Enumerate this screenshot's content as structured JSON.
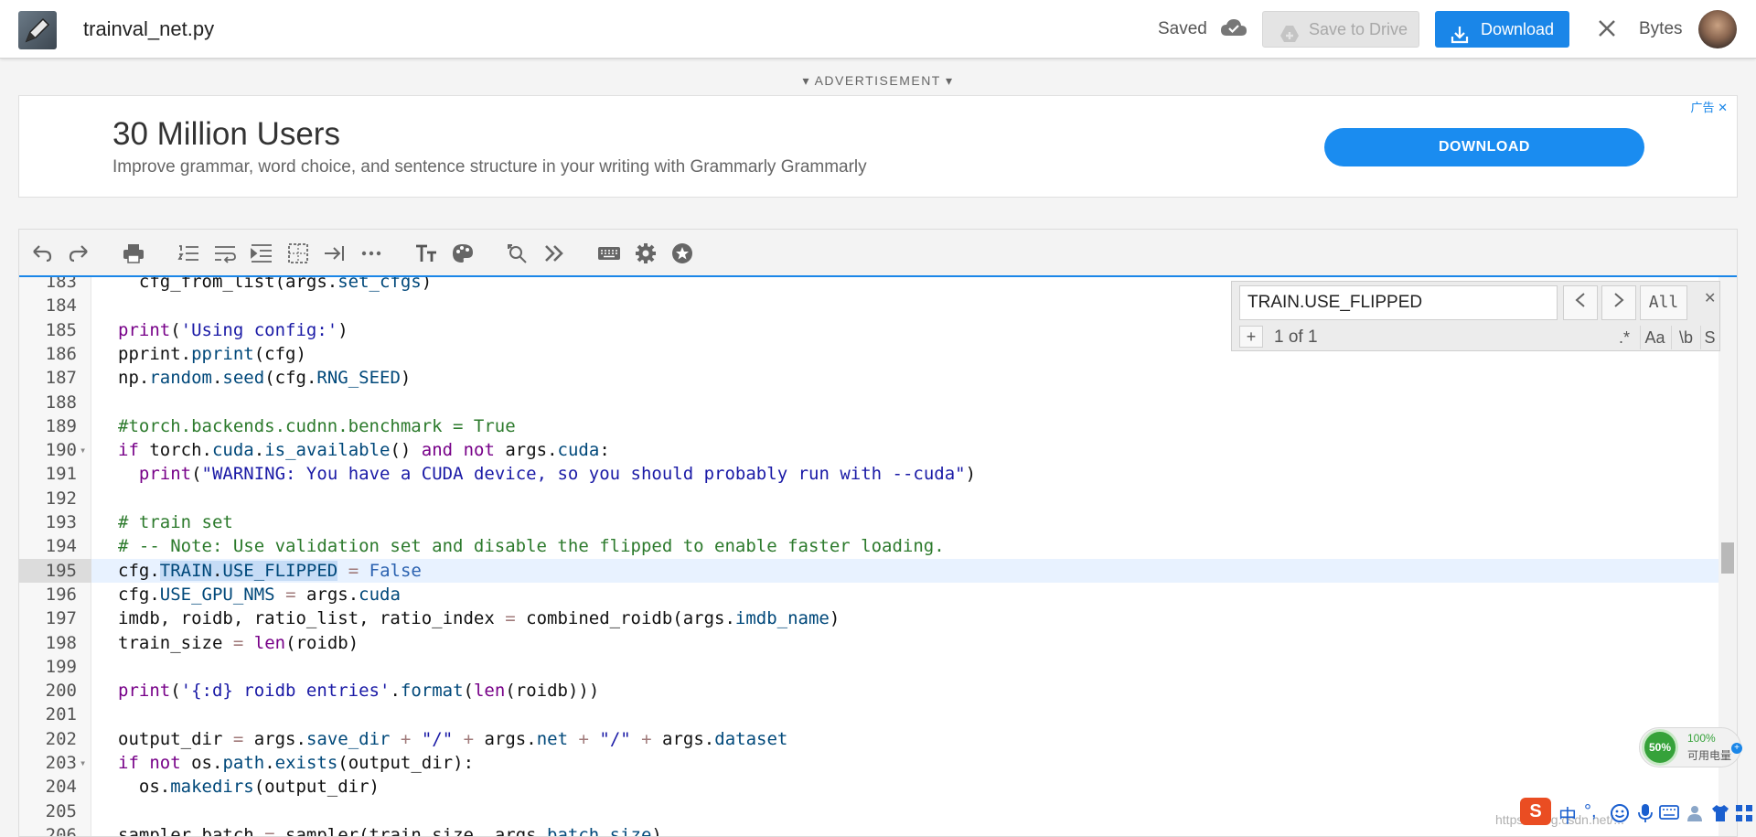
{
  "header": {
    "filename": "trainval_net.py",
    "status": "Saved",
    "save_to_drive": "Save to Drive",
    "download": "Download",
    "user": "Bytes"
  },
  "ad": {
    "label": "▾ ADVERTISEMENT ▾",
    "title": "30 Million Users",
    "text": "Improve grammar, word choice, and sentence structure in your writing with Grammarly Grammarly",
    "cta": "DOWNLOAD",
    "choice": "广告 ✕"
  },
  "search": {
    "query": "TRAIN.USE_FLIPPED",
    "prev": "<",
    "next": ">",
    "all": "All",
    "close": "✕",
    "plus": "+",
    "count": "1 of 1",
    "regex": ".*",
    "case": "Aa",
    "word": "\\b",
    "selection": "S"
  },
  "widgets": {
    "battery_ring": "50%",
    "battery_pct": "100%",
    "battery_label": "可用电量",
    "ime_logo": "S",
    "ime_lang": "中",
    "ime_punct": "°,",
    "watermark": "https://blog.csdn.net/..."
  },
  "code": {
    "lines": [
      {
        "n": "183",
        "html": "  cfg_from_list(args.<span class=\"prop\">set_cfgs</span>)"
      },
      {
        "n": "184",
        "html": ""
      },
      {
        "n": "185",
        "html": "<span class=\"kw\">print</span>(<span class=\"str\">'Using config:'</span>)"
      },
      {
        "n": "186",
        "html": "pprint.<span class=\"prop\">pprint</span>(cfg)"
      },
      {
        "n": "187",
        "html": "np.<span class=\"prop\">random</span>.<span class=\"prop\">seed</span>(cfg.<span class=\"prop\">RNG_SEED</span>)"
      },
      {
        "n": "188",
        "html": ""
      },
      {
        "n": "189",
        "html": "<span class=\"cm\">#torch.backends.cudnn.benchmark = True</span>"
      },
      {
        "n": "190",
        "fold": true,
        "html": "<span class=\"kw\">if</span> torch.<span class=\"prop\">cuda</span>.<span class=\"prop\">is_available</span>() <span class=\"kw\">and</span> <span class=\"kw\">not</span> args.<span class=\"prop\">cuda</span>:"
      },
      {
        "n": "191",
        "html": "  <span class=\"kw\">print</span>(<span class=\"str\">\"WARNING: You have a CUDA device, so you should probably run with --cuda\"</span>)"
      },
      {
        "n": "192",
        "html": ""
      },
      {
        "n": "193",
        "html": "<span class=\"cm\"># train set</span>"
      },
      {
        "n": "194",
        "html": "<span class=\"cm\"># -- Note: Use validation set and disable the flipped to enable faster loading.</span>"
      },
      {
        "n": "195",
        "active": true,
        "html": "cfg.<span class=\"hl\"><span class=\"prop\">TRAIN</span>.<span class=\"prop\">USE_FLIPPED</span></span> <span class=\"op\">=</span> <span class=\"atom\">False</span>"
      },
      {
        "n": "196",
        "html": "cfg.<span class=\"prop\">USE_GPU_NMS</span> <span class=\"op\">=</span> args.<span class=\"prop\">cuda</span>"
      },
      {
        "n": "197",
        "html": "imdb, roidb, ratio_list, ratio_index <span class=\"op\">=</span> combined_roidb(args.<span class=\"prop\">imdb_name</span>)"
      },
      {
        "n": "198",
        "html": "train_size <span class=\"op\">=</span> <span class=\"kw\">len</span>(roidb)"
      },
      {
        "n": "199",
        "html": ""
      },
      {
        "n": "200",
        "html": "<span class=\"kw\">print</span>(<span class=\"str\">'{:d} roidb entries'</span>.<span class=\"prop\">format</span>(<span class=\"kw\">len</span>(roidb)))"
      },
      {
        "n": "201",
        "html": ""
      },
      {
        "n": "202",
        "html": "output_dir <span class=\"op\">=</span> args.<span class=\"prop\">save_dir</span> <span class=\"op\">+</span> <span class=\"str\">\"/\"</span> <span class=\"op\">+</span> args.<span class=\"prop\">net</span> <span class=\"op\">+</span> <span class=\"str\">\"/\"</span> <span class=\"op\">+</span> args.<span class=\"prop\">dataset</span>"
      },
      {
        "n": "203",
        "fold": true,
        "html": "<span class=\"kw\">if</span> <span class=\"kw\">not</span> os.<span class=\"prop\">path</span>.<span class=\"prop\">exists</span>(output_dir):"
      },
      {
        "n": "204",
        "html": "  os.<span class=\"prop\">makedirs</span>(output_dir)"
      },
      {
        "n": "205",
        "html": ""
      },
      {
        "n": "206",
        "html": "sampler_batch <span class=\"op\">=</span> sampler(train_size, args.<span class=\"prop\">batch_size</span>)"
      }
    ]
  }
}
